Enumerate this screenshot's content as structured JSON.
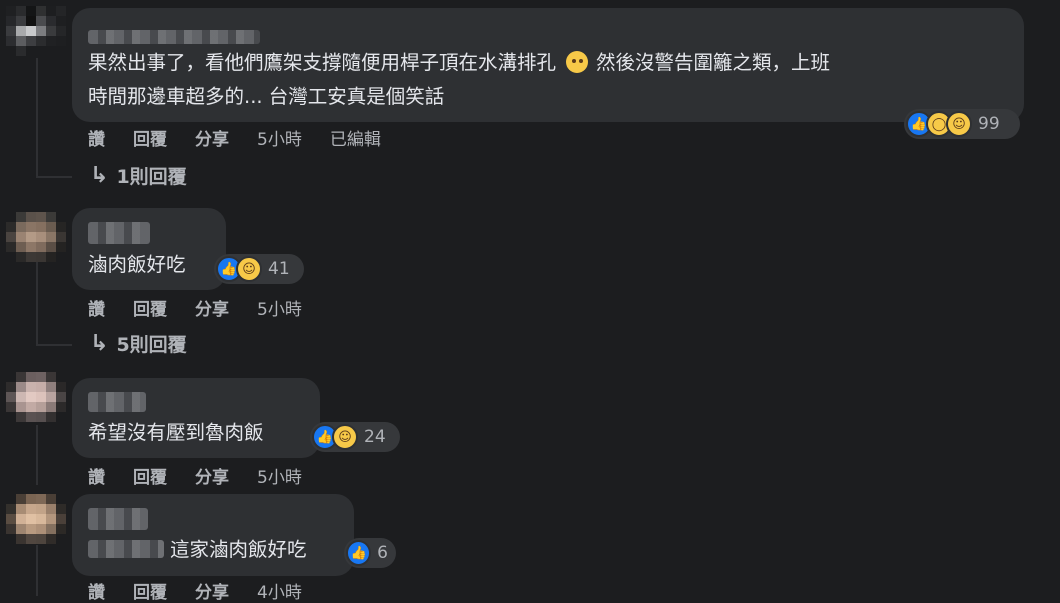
{
  "comments": [
    {
      "text_line1": "果然出事了，看他們鷹架支撐隨便用桿子頂在水溝排孔",
      "text_line1b": "然後沒警告圍籬之類，上班",
      "text_line2": "時間那邊車超多的... 台灣工安真是個笑話",
      "reaction_count": "99",
      "actions": {
        "like": "讚",
        "reply": "回覆",
        "share": "分享",
        "time": "5小時",
        "edited": "已編輯"
      },
      "replies_label": "1則回覆",
      "emoji_inline": "rolling-eyes-emoji"
    },
    {
      "text_line1": "滷肉飯好吃",
      "reaction_count": "41",
      "actions": {
        "like": "讚",
        "reply": "回覆",
        "share": "分享",
        "time": "5小時"
      },
      "replies_label": "5則回覆"
    },
    {
      "text_line1": "希望沒有壓到魯肉飯",
      "reaction_count": "24",
      "actions": {
        "like": "讚",
        "reply": "回覆",
        "share": "分享",
        "time": "5小時"
      }
    },
    {
      "text_line1": "這家滷肉飯好吃",
      "reaction_count": "6",
      "actions": {
        "like": "讚",
        "reply": "回覆",
        "share": "分享",
        "time": "4小時"
      }
    }
  ],
  "icons": {
    "like": "like-icon",
    "wow": "wow-icon",
    "haha": "haha-icon",
    "reply_arrow": "reply-arrow-icon"
  },
  "colors": {
    "background": "#1c1d1f",
    "bubble": "#2e3033",
    "like_blue": "#1877f2",
    "muted_text": "#b0b3b8"
  }
}
